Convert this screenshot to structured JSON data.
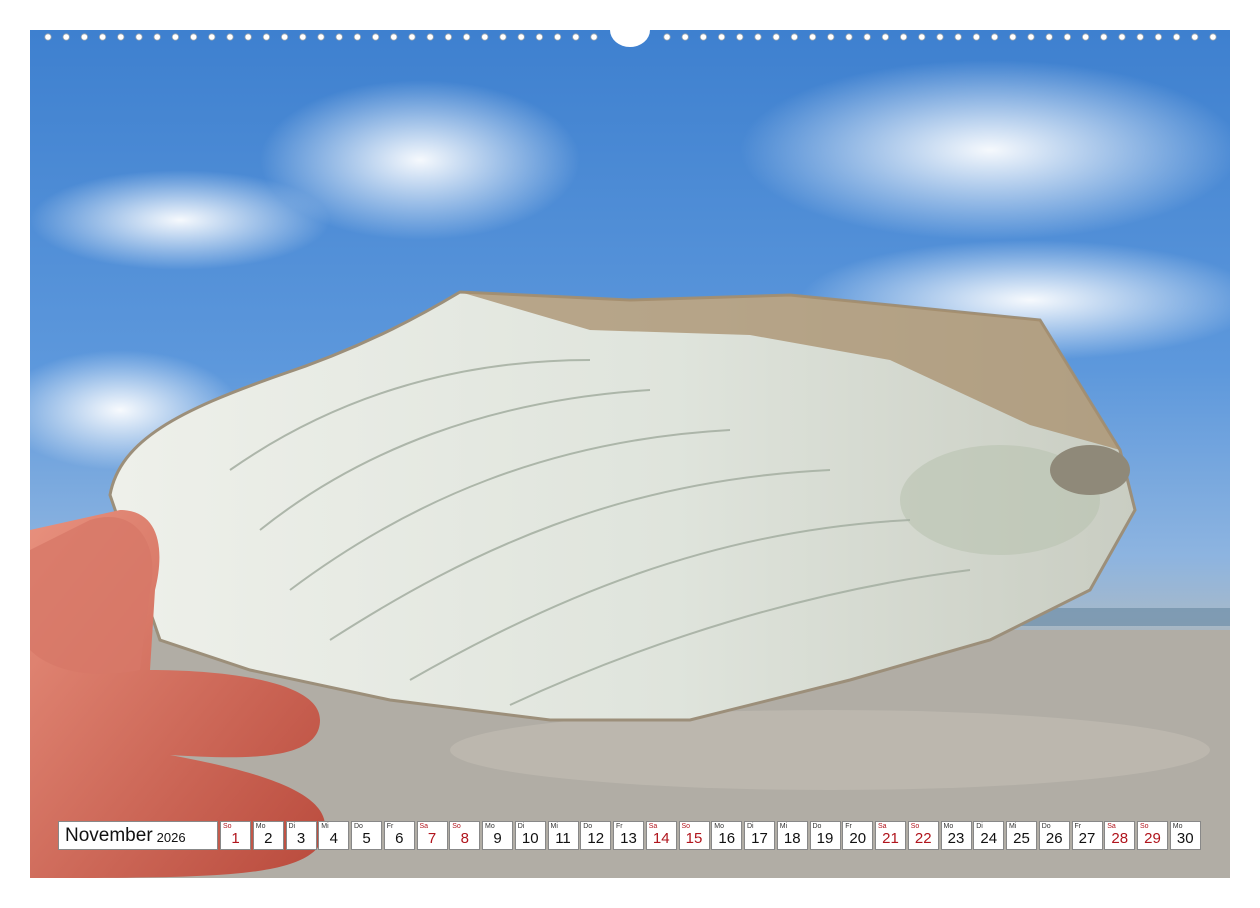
{
  "calendar": {
    "month": "November",
    "year": "2026",
    "days": [
      {
        "wd": "So",
        "n": "1",
        "red": true
      },
      {
        "wd": "Mo",
        "n": "2",
        "red": false
      },
      {
        "wd": "Di",
        "n": "3",
        "red": false
      },
      {
        "wd": "Mi",
        "n": "4",
        "red": false
      },
      {
        "wd": "Do",
        "n": "5",
        "red": false
      },
      {
        "wd": "Fr",
        "n": "6",
        "red": false
      },
      {
        "wd": "Sa",
        "n": "7",
        "red": true
      },
      {
        "wd": "So",
        "n": "8",
        "red": true
      },
      {
        "wd": "Mo",
        "n": "9",
        "red": false
      },
      {
        "wd": "Di",
        "n": "10",
        "red": false
      },
      {
        "wd": "Mi",
        "n": "11",
        "red": false
      },
      {
        "wd": "Do",
        "n": "12",
        "red": false
      },
      {
        "wd": "Fr",
        "n": "13",
        "red": false
      },
      {
        "wd": "Sa",
        "n": "14",
        "red": true
      },
      {
        "wd": "So",
        "n": "15",
        "red": true
      },
      {
        "wd": "Mo",
        "n": "16",
        "red": false
      },
      {
        "wd": "Di",
        "n": "17",
        "red": false
      },
      {
        "wd": "Mi",
        "n": "18",
        "red": false
      },
      {
        "wd": "Do",
        "n": "19",
        "red": false
      },
      {
        "wd": "Fr",
        "n": "20",
        "red": false
      },
      {
        "wd": "Sa",
        "n": "21",
        "red": true
      },
      {
        "wd": "So",
        "n": "22",
        "red": true
      },
      {
        "wd": "Mo",
        "n": "23",
        "red": false
      },
      {
        "wd": "Di",
        "n": "24",
        "red": false
      },
      {
        "wd": "Mi",
        "n": "25",
        "red": false
      },
      {
        "wd": "Do",
        "n": "26",
        "red": false
      },
      {
        "wd": "Fr",
        "n": "27",
        "red": false
      },
      {
        "wd": "Sa",
        "n": "28",
        "red": true
      },
      {
        "wd": "So",
        "n": "29",
        "red": true
      },
      {
        "wd": "Mo",
        "n": "30",
        "red": false
      }
    ]
  },
  "colors": {
    "sunday_saturday": "#b0141c",
    "text": "#111111"
  }
}
